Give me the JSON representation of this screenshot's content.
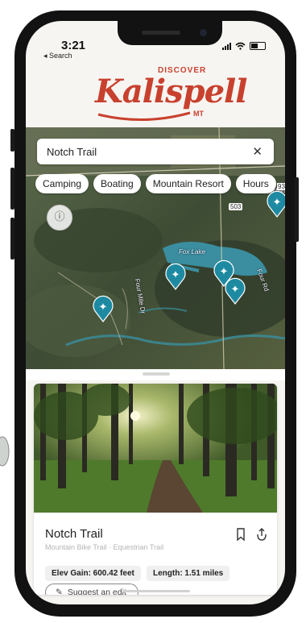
{
  "status_bar": {
    "time": "3:21",
    "back_label": "◂ Search"
  },
  "logo": {
    "top": "DISCOVER",
    "main": "Kalispell",
    "state": "MT"
  },
  "search": {
    "query": "Notch Trail",
    "clear_icon": "close-icon"
  },
  "filters": [
    "Camping",
    "Boating",
    "Mountain Resort",
    "Hours"
  ],
  "map": {
    "labels": {
      "lake": "Fox Lake",
      "road1": "Four Mile Dr",
      "road2": "Four Rd",
      "northwest": "NORTHWE",
      "hwy": "503",
      "hwy2": "93"
    },
    "pin_icon": "hiker-icon",
    "pin_color": "#1e8aa2"
  },
  "trail": {
    "name": "Notch Trail",
    "categories": "Mountain Bike Trail · Equestrian Trail",
    "elevation": "Elev Gain: 600.42 feet",
    "length": "Length: 1.51 miles",
    "suggest_label": "Suggest an edit"
  },
  "colors": {
    "brand": "#c8412e",
    "accent": "#1e8aa2"
  }
}
